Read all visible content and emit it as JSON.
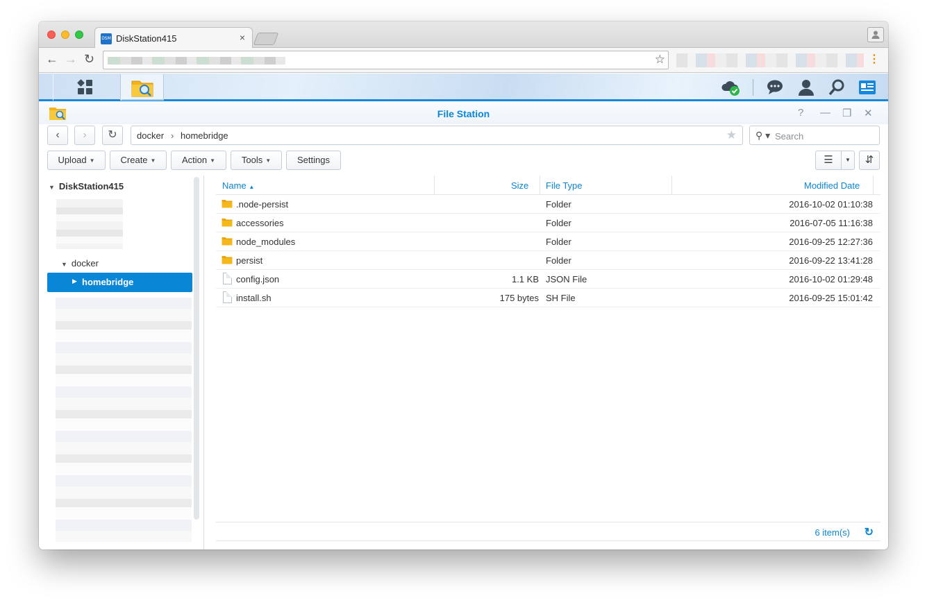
{
  "browser": {
    "tab_title": "DiskStation415",
    "favicon_text": "DSM",
    "close_glyph": "×",
    "icons": {
      "back": "arrow-left-icon",
      "forward": "arrow-right-icon",
      "reload": "reload-icon",
      "bookmark": "star-icon",
      "menu": "kebab-menu-icon",
      "profile": "person-icon"
    }
  },
  "dsm_taskbar": {
    "icons": [
      "main-menu-grid-icon",
      "file-station-app-icon",
      "cloud-sync-status-icon",
      "chat-icon",
      "user-icon",
      "search-icon",
      "widgets-icon"
    ]
  },
  "file_station": {
    "title": "File Station",
    "window_controls": [
      "help-icon",
      "minimize-icon",
      "restore-icon",
      "close-icon"
    ],
    "path": [
      "docker",
      "homebridge"
    ],
    "path_separator": "›",
    "search_placeholder": "Search",
    "toolbar": {
      "upload": "Upload",
      "create": "Create",
      "action": "Action",
      "tools": "Tools",
      "settings": "Settings"
    },
    "tree": {
      "root": "DiskStation415",
      "docker": "docker",
      "selected": "homebridge"
    },
    "columns": {
      "name": "Name",
      "name_sort": "▲",
      "size": "Size",
      "type": "File Type",
      "modified": "Modified Date"
    },
    "files": [
      {
        "name": ".node-persist",
        "size": "",
        "type": "Folder",
        "modified": "2016-10-02 01:10:38",
        "kind": "folder"
      },
      {
        "name": "accessories",
        "size": "",
        "type": "Folder",
        "modified": "2016-07-05 11:16:38",
        "kind": "folder"
      },
      {
        "name": "node_modules",
        "size": "",
        "type": "Folder",
        "modified": "2016-09-25 12:27:36",
        "kind": "folder"
      },
      {
        "name": "persist",
        "size": "",
        "type": "Folder",
        "modified": "2016-09-22 13:41:28",
        "kind": "folder"
      },
      {
        "name": "config.json",
        "size": "1.1 KB",
        "type": "JSON File",
        "modified": "2016-10-02 01:29:48",
        "kind": "file"
      },
      {
        "name": "install.sh",
        "size": "175 bytes",
        "type": "SH File",
        "modified": "2016-09-25 15:01:42",
        "kind": "file"
      }
    ],
    "status": "6 item(s)"
  },
  "colors": {
    "accent": "#0a86d6",
    "folder": "#f4b81b",
    "selected_bg": "#0a86d6"
  }
}
